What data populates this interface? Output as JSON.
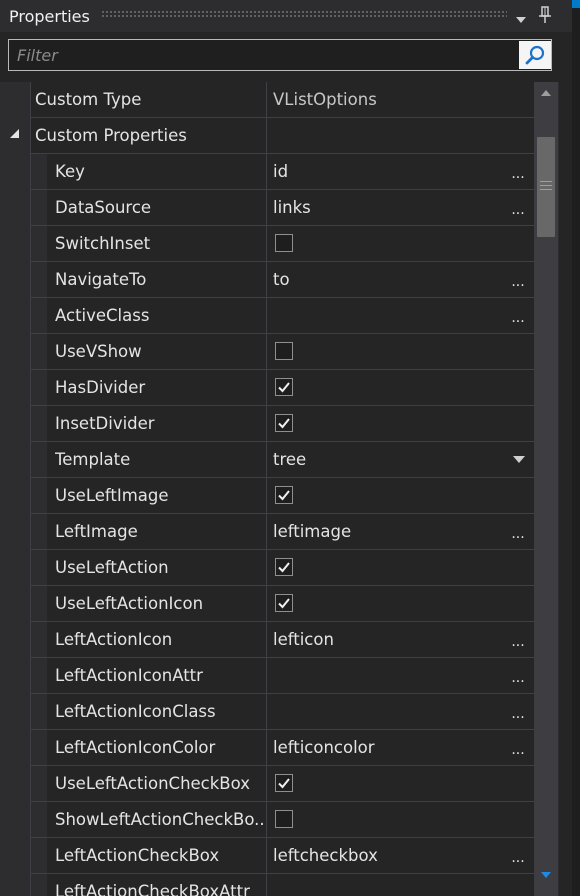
{
  "panel": {
    "title": "Properties"
  },
  "search": {
    "placeholder": "Filter",
    "value": ""
  },
  "icons": {
    "dropdown": "chevron-down-icon",
    "pin": "pin-icon",
    "search": "search-icon",
    "expand": "expand-triangle-icon",
    "ellipsis": "ellipsis-button",
    "checkbox": "checkbox",
    "dropdown_caret": "dropdown-caret-icon",
    "scroll_up": "scroll-up-arrow-icon",
    "scroll_down": "scroll-down-arrow-icon"
  },
  "colors": {
    "background": "#252526",
    "titlebar": "#2d2d30",
    "gridline": "#3f3f46",
    "text": "#e4e4e4",
    "accent": "#007acc"
  },
  "custom_type": {
    "label": "Custom Type",
    "value": "VListOptions"
  },
  "category": {
    "label": "Custom Properties",
    "expanded": true
  },
  "properties": [
    {
      "name": "Key",
      "kind": "text",
      "value": "id",
      "ellipsis": "..."
    },
    {
      "name": "DataSource",
      "kind": "text",
      "value": "links",
      "ellipsis": "..."
    },
    {
      "name": "SwitchInset",
      "kind": "checkbox",
      "checked": false
    },
    {
      "name": "NavigateTo",
      "kind": "text",
      "value": "to",
      "ellipsis": "..."
    },
    {
      "name": "ActiveClass",
      "kind": "text",
      "value": "",
      "ellipsis": "..."
    },
    {
      "name": "UseVShow",
      "kind": "checkbox",
      "checked": false
    },
    {
      "name": "HasDivider",
      "kind": "checkbox",
      "checked": true
    },
    {
      "name": "InsetDivider",
      "kind": "checkbox",
      "checked": true
    },
    {
      "name": "Template",
      "kind": "dropdown",
      "value": "tree"
    },
    {
      "name": "UseLeftImage",
      "kind": "checkbox",
      "checked": true
    },
    {
      "name": "LeftImage",
      "kind": "text",
      "value": "leftimage",
      "ellipsis": "..."
    },
    {
      "name": "UseLeftAction",
      "kind": "checkbox",
      "checked": true
    },
    {
      "name": "UseLeftActionIcon",
      "kind": "checkbox",
      "checked": true
    },
    {
      "name": "LeftActionIcon",
      "kind": "text",
      "value": "lefticon",
      "ellipsis": "..."
    },
    {
      "name": "LeftActionIconAttr",
      "kind": "text",
      "value": "",
      "ellipsis": "..."
    },
    {
      "name": "LeftActionIconClass",
      "kind": "text",
      "value": "",
      "ellipsis": "..."
    },
    {
      "name": "LeftActionIconColor",
      "kind": "text",
      "value": "lefticoncolor",
      "ellipsis": "..."
    },
    {
      "name": "UseLeftActionCheckBox",
      "kind": "checkbox",
      "checked": true
    },
    {
      "name": "ShowLeftActionCheckBo...",
      "kind": "checkbox",
      "checked": false
    },
    {
      "name": "LeftActionCheckBox",
      "kind": "text",
      "value": "leftcheckbox",
      "ellipsis": "..."
    },
    {
      "name": "LeftActionCheckBoxAttr",
      "kind": "text",
      "value": "",
      "ellipsis": ""
    }
  ]
}
